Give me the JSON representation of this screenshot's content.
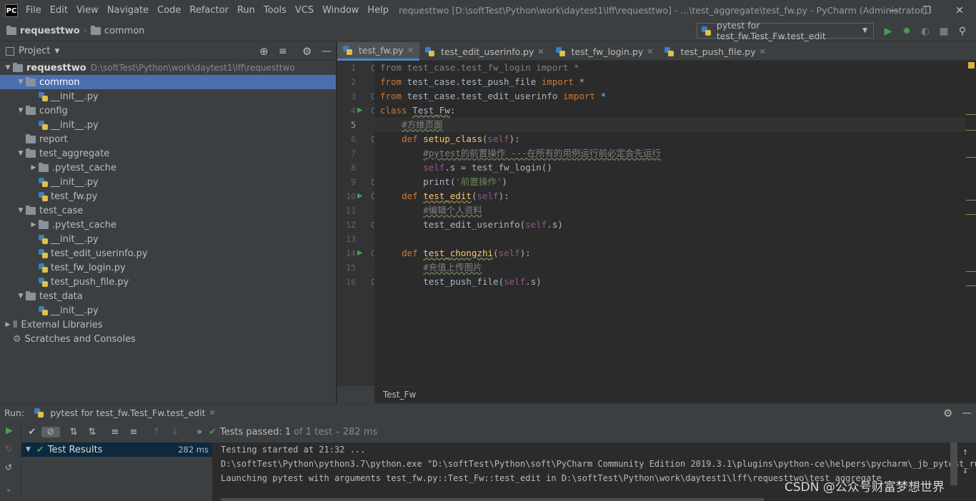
{
  "titlebar": {
    "logo": "PC",
    "menu": [
      "File",
      "Edit",
      "View",
      "Navigate",
      "Code",
      "Refactor",
      "Run",
      "Tools",
      "VCS",
      "Window",
      "Help"
    ],
    "window_title": "requesttwo [D:\\softTest\\Python\\work\\daytest1\\lff\\requesttwo] - ...\\test_aggregate\\test_fw.py - PyCharm (Administrator)",
    "win_buttons": [
      "minimize-icon",
      "restore-icon",
      "close-icon"
    ]
  },
  "navbar": {
    "root": "requesttwo",
    "folder": "common",
    "run_config": "pytest for test_fw.Test_Fw.test_edit"
  },
  "project": {
    "header": "Project",
    "tree": [
      {
        "label": "requesttwo",
        "path": "D:\\softTest\\Python\\work\\daytest1\\lff\\requesttwo",
        "indent": 0,
        "type": "folder",
        "open": true
      },
      {
        "label": "common",
        "indent": 1,
        "type": "folder",
        "open": true,
        "selected": true
      },
      {
        "label": "__init__.py",
        "indent": 2,
        "type": "py"
      },
      {
        "label": "config",
        "indent": 1,
        "type": "folder",
        "open": true
      },
      {
        "label": "__init__.py",
        "indent": 2,
        "type": "py"
      },
      {
        "label": "report",
        "indent": 1,
        "type": "folder",
        "leaf": true
      },
      {
        "label": "test_aggregate",
        "indent": 1,
        "type": "folder",
        "open": true
      },
      {
        "label": ".pytest_cache",
        "indent": 2,
        "type": "folder",
        "open": false
      },
      {
        "label": "__init__.py",
        "indent": 2,
        "type": "py"
      },
      {
        "label": "test_fw.py",
        "indent": 2,
        "type": "py"
      },
      {
        "label": "test_case",
        "indent": 1,
        "type": "folder",
        "open": true
      },
      {
        "label": ".pytest_cache",
        "indent": 2,
        "type": "folder",
        "open": false
      },
      {
        "label": "__init__.py",
        "indent": 2,
        "type": "py"
      },
      {
        "label": "test_edit_userinfo.py",
        "indent": 2,
        "type": "py"
      },
      {
        "label": "test_fw_login.py",
        "indent": 2,
        "type": "py"
      },
      {
        "label": "test_push_file.py",
        "indent": 2,
        "type": "py"
      },
      {
        "label": "test_data",
        "indent": 1,
        "type": "folder",
        "open": true
      },
      {
        "label": "__init__.py",
        "indent": 2,
        "type": "py"
      },
      {
        "label": "External Libraries",
        "indent": 0,
        "type": "lib",
        "open": false
      },
      {
        "label": "Scratches and Consoles",
        "indent": 0,
        "type": "scratch",
        "leaf": true
      }
    ]
  },
  "tabs": [
    {
      "label": "test_fw.py",
      "active": true
    },
    {
      "label": "test_edit_userinfo.py"
    },
    {
      "label": "test_fw_login.py"
    },
    {
      "label": "test_push_file.py"
    }
  ],
  "code_breadcrumb": "Test_Fw",
  "run": {
    "label": "Run:",
    "tab": "pytest for test_fw.Test_Fw.test_edit",
    "status_prefix": "Tests passed:",
    "status_count": "1",
    "status_rest": "of 1 test – 282 ms",
    "tree_item": "Test Results",
    "tree_time": "282 ms",
    "console": [
      "Testing started at 21:32 ...",
      "D:\\softTest\\Python\\python3.7\\python.exe \"D:\\softTest\\Python\\soft\\PyCharm Community Edition 2019.3.1\\plugins\\python-ce\\helpers\\pycharm\\_jb_pytest_ru",
      "Launching pytest with arguments test_fw.py::Test_Fw::test_edit in D:\\softTest\\Python\\work\\daytest1\\lff\\requesttwo\\test_aggregate"
    ]
  },
  "watermark": "CSDN @公众号财富梦想世界"
}
